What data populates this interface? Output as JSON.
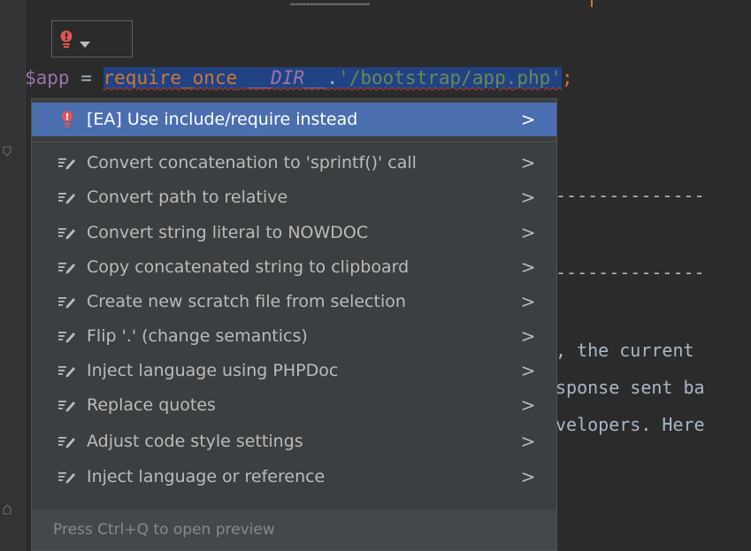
{
  "editor": {
    "code_tokens": [
      {
        "cls": "tok-var",
        "text": "$app"
      },
      {
        "cls": "tok-op",
        "text": " = "
      },
      {
        "cls": "tok-sel tok-kw",
        "text": "require_once"
      },
      {
        "cls": "tok-sel",
        "text": " "
      },
      {
        "cls": "tok-sel tok-const",
        "text": "__DIR__"
      },
      {
        "cls": "tok-sel tok-op",
        "text": "."
      },
      {
        "cls": "tok-sel tok-str",
        "text": "'/bootstrap/app.php'"
      },
      {
        "cls": "tok-semi",
        "text": ";"
      }
    ],
    "bg_lines": [
      "--------------",
      "--------------",
      ", the current",
      "sponse sent ba",
      "velopers. Here"
    ]
  },
  "intention_menu": {
    "items": [
      {
        "label": "[EA] Use include/require instead",
        "icon": "bulb-red-icon",
        "selected": true
      },
      {
        "label": "Convert concatenation to 'sprintf()' call",
        "icon": "intention-pencil-icon"
      },
      {
        "label": "Convert path to relative",
        "icon": "intention-pencil-icon"
      },
      {
        "label": "Convert string literal to NOWDOC",
        "icon": "intention-pencil-icon"
      },
      {
        "label": "Copy concatenated string to clipboard",
        "icon": "intention-pencil-icon"
      },
      {
        "label": "Create new scratch file from selection",
        "icon": "intention-pencil-icon"
      },
      {
        "label": "Flip '.' (change semantics)",
        "icon": "intention-pencil-icon"
      },
      {
        "label": "Inject language using PHPDoc",
        "icon": "intention-pencil-icon"
      },
      {
        "label": "Replace quotes",
        "icon": "intention-pencil-icon"
      },
      {
        "label": "Adjust code style settings",
        "icon": "intention-pencil-icon"
      },
      {
        "label": "Inject language or reference",
        "icon": "intention-pencil-icon"
      }
    ],
    "submenu_arrow": ">",
    "footer": "Press Ctrl+Q to open preview"
  },
  "colors": {
    "editor_bg": "#2b2b2b",
    "popup_bg": "#3c3f41",
    "selection": "#4b6eaf",
    "bulb_red": "#e05555"
  }
}
